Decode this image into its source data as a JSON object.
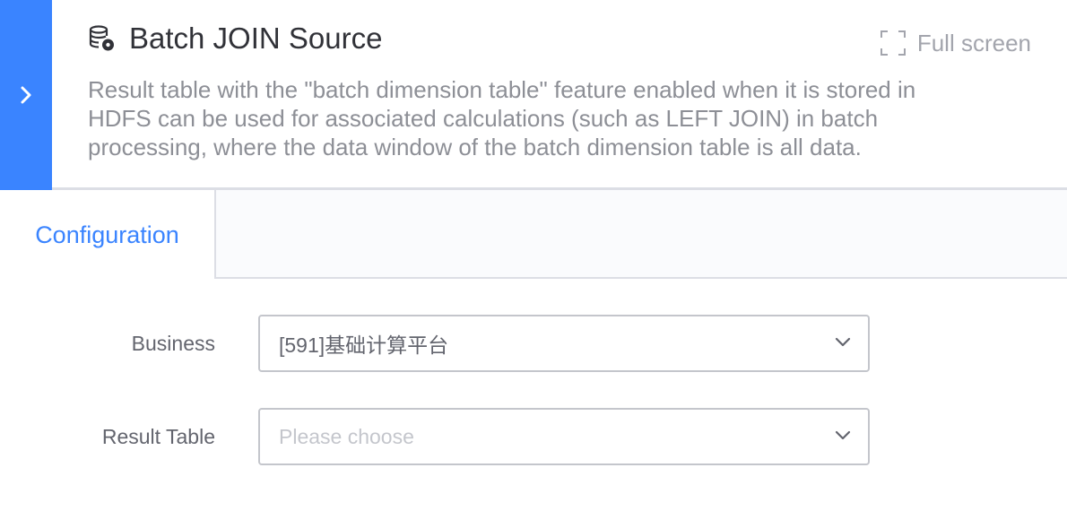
{
  "header": {
    "title": "Batch JOIN Source",
    "title_icon": "database-gear-icon",
    "fullscreen_label": "Full screen",
    "fullscreen_icon": "fullscreen-icon",
    "description": "Result table with the \"batch dimension table\" feature enabled when it is stored in HDFS can be used for associated calculations (such as LEFT JOIN) in batch processing, where the data window of the batch dimension table is all data.",
    "collapse_icon": "chevron-right-icon"
  },
  "tabs": [
    {
      "label": "Configuration",
      "active": true
    }
  ],
  "form": {
    "business": {
      "label": "Business",
      "value": "[591]基础计算平台"
    },
    "result_table": {
      "label": "Result Table",
      "placeholder": "Please choose",
      "value": ""
    }
  },
  "colors": {
    "accent": "#3a84ff",
    "title": "#313238",
    "muted": "#8d8f96",
    "border": "#dcdee5",
    "placeholder": "#c4c6cc"
  }
}
